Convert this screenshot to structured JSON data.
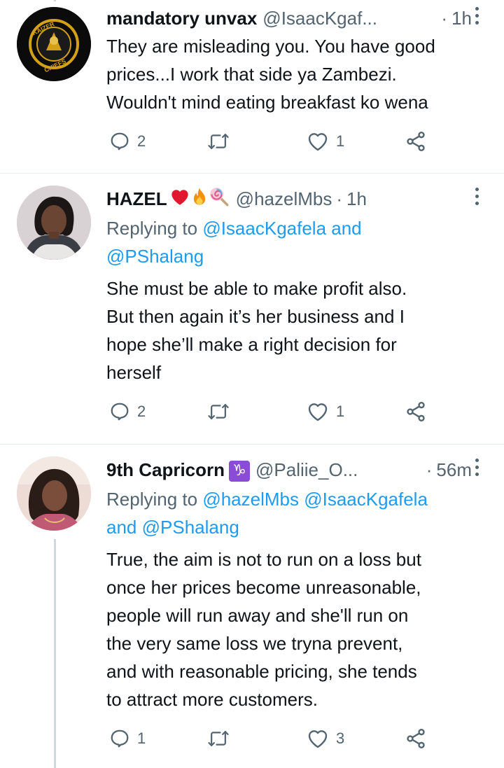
{
  "tweets": [
    {
      "name": "mandatory unvax",
      "handle": "@IsaacKgaf...",
      "time": "1h",
      "avatar_text": "KAIZER CHIEFS",
      "text_lines": [
        "They are misleading you. You have good",
        "prices...I work that side ya Zambezi.",
        "Wouldn't mind eating breakfast ko wena"
      ],
      "replies": "2",
      "retweets": "",
      "likes": "1"
    },
    {
      "name": "HAZEL",
      "handle": "@hazelMbs",
      "time": "1h",
      "replying_prefix": "Replying to",
      "replying_mentions": [
        "@IsaacKgafela and",
        "@PShalang"
      ],
      "text_lines": [
        "She must be able to make profit also.",
        "But then again it’s her business and I",
        "hope she’ll make a right decision for",
        "herself"
      ],
      "replies": "2",
      "retweets": "",
      "likes": "1"
    },
    {
      "name": "9th Capricorn",
      "handle": "@Paliie_O...",
      "time": "56m",
      "zodiac_symbol": "♑",
      "replying_prefix": "Replying to",
      "replying_line1_mentions": "@hazelMbs @IsaacKgafela",
      "replying_line2_word": "and",
      "replying_line2_mention": "@PShalang",
      "text_lines": [
        "True, the aim is not to run on a loss but",
        "once her prices become unreasonable,",
        "people will run away and she'll run on",
        "the very same loss we tryna prevent,",
        "and with reasonable pricing, she tends",
        "to attract more customers."
      ],
      "replies": "1",
      "retweets": "",
      "likes": "3"
    }
  ],
  "icons": {
    "reply": "reply-bubble-icon",
    "retweet": "retweet-icon",
    "like": "heart-icon",
    "share": "share-icon",
    "more": "more-vertical-icon"
  },
  "colors": {
    "text": "#0f1419",
    "secondary": "#536471",
    "link": "#1d9bf0",
    "divider": "#e7ecf0",
    "thread_line": "#cfd9de"
  }
}
